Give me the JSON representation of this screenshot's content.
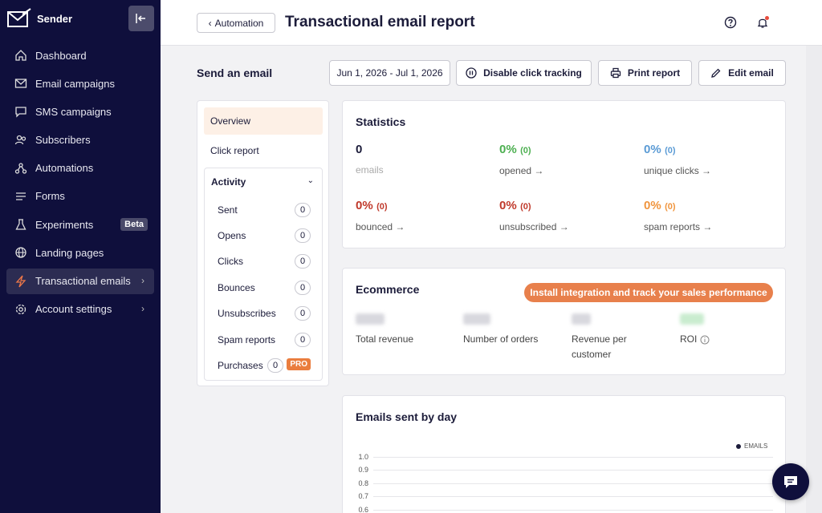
{
  "brand": {
    "name": "Sender"
  },
  "sidebar": {
    "items": [
      {
        "label": "Dashboard",
        "icon": "home-icon"
      },
      {
        "label": "Email campaigns",
        "icon": "mail-icon"
      },
      {
        "label": "SMS campaigns",
        "icon": "chat-icon"
      },
      {
        "label": "Subscribers",
        "icon": "users-icon"
      },
      {
        "label": "Automations",
        "icon": "automation-icon"
      },
      {
        "label": "Forms",
        "icon": "forms-icon"
      },
      {
        "label": "Experiments",
        "icon": "flask-icon",
        "badge": "Beta"
      },
      {
        "label": "Landing pages",
        "icon": "globe-icon"
      },
      {
        "label": "Transactional emails",
        "icon": "bolt-icon",
        "active": true
      },
      {
        "label": "Account settings",
        "icon": "gear-icon"
      }
    ]
  },
  "header": {
    "back_label": "Automation",
    "title": "Transactional email report"
  },
  "toolbar": {
    "heading": "Send an email",
    "date_range": "Jun 1, 2026 - Jul 1, 2026",
    "disable_tracking": "Disable click tracking",
    "print": "Print report",
    "edit": "Edit email"
  },
  "tabs": {
    "overview": "Overview",
    "click_report": "Click report"
  },
  "activity": {
    "heading": "Activity",
    "rows": [
      {
        "label": "Sent",
        "count": "0"
      },
      {
        "label": "Opens",
        "count": "0"
      },
      {
        "label": "Clicks",
        "count": "0"
      },
      {
        "label": "Bounces",
        "count": "0"
      },
      {
        "label": "Unsubscribes",
        "count": "0"
      },
      {
        "label": "Spam reports",
        "count": "0"
      },
      {
        "label": "Purchases",
        "count": "0",
        "badge": "PRO"
      }
    ]
  },
  "statistics": {
    "title": "Statistics",
    "emails": {
      "value": "0",
      "label": "emails"
    },
    "opened": {
      "value": "0%",
      "sub": "(0)",
      "label": "opened →",
      "color": "#4caf50"
    },
    "unique_clicks": {
      "value": "0%",
      "sub": "(0)",
      "label": "unique clicks →",
      "color": "#5b9bd5"
    },
    "bounced": {
      "value": "0%",
      "sub": "(0)",
      "label": "bounced →",
      "color": "#c0392b"
    },
    "unsubscribed": {
      "value": "0%",
      "sub": "(0)",
      "label": "unsubscribed →",
      "color": "#c0392b"
    },
    "spam_reports": {
      "value": "0%",
      "sub": "(0)",
      "label": "spam reports →",
      "color": "#f0953e"
    }
  },
  "ecommerce": {
    "title": "Ecommerce",
    "install_label": "Install integration and track your sales performance",
    "total_revenue": "Total revenue",
    "number_of_orders": "Number of orders",
    "revenue_per_customer": "Revenue per customer",
    "roi": "ROI"
  },
  "chart": {
    "title": "Emails sent by day",
    "legend": "EMAILS",
    "ticks": [
      "1.0",
      "0.9",
      "0.8",
      "0.7",
      "0.6"
    ]
  },
  "chart_data": {
    "type": "line",
    "title": "Emails sent by day",
    "series": [
      {
        "name": "EMAILS",
        "values": []
      }
    ],
    "ylim": [
      0.6,
      1.0
    ]
  },
  "colors": {
    "sidebar": "#0f0f3c",
    "accent": "#e8804c"
  }
}
